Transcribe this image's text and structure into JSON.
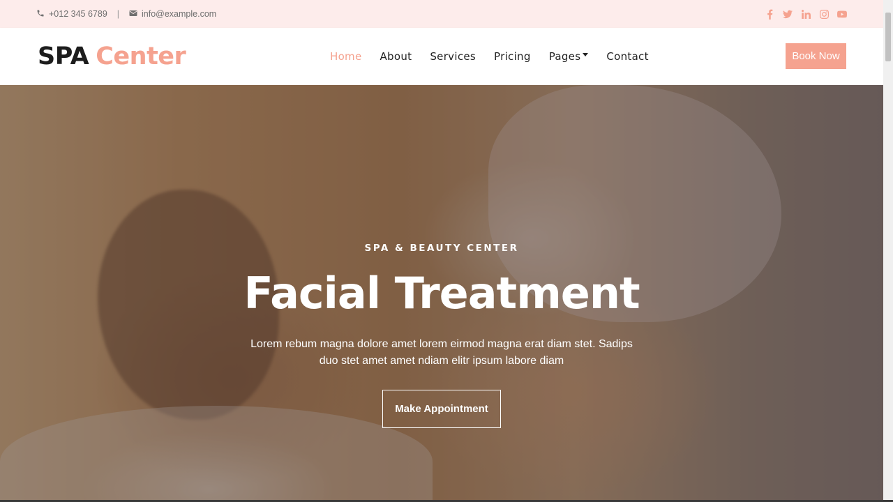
{
  "topbar": {
    "phone": "+012 345 6789",
    "separator": "|",
    "email": "info@example.com",
    "social": [
      "facebook-icon",
      "twitter-icon",
      "linkedin-icon",
      "instagram-icon",
      "youtube-icon"
    ]
  },
  "brand": {
    "part1": "SPA",
    "part2": "Center"
  },
  "nav": {
    "items": [
      {
        "label": "Home",
        "active": true
      },
      {
        "label": "About"
      },
      {
        "label": "Services"
      },
      {
        "label": "Pricing"
      },
      {
        "label": "Pages"
      },
      {
        "label": "Contact"
      }
    ],
    "book_label": "Book Now"
  },
  "hero": {
    "eyebrow": "SPA & BEAUTY CENTER",
    "title": "Facial Treatment",
    "description": "Lorem rebum magna dolore amet lorem eirmod magna erat diam stet. Sadips duo stet amet amet ndiam elitr ipsum labore diam",
    "cta_label": "Make Appointment"
  },
  "colors": {
    "accent": "#f5a28f",
    "topbar_bg": "#fdeceb",
    "text_dark": "#1d1d1d"
  }
}
